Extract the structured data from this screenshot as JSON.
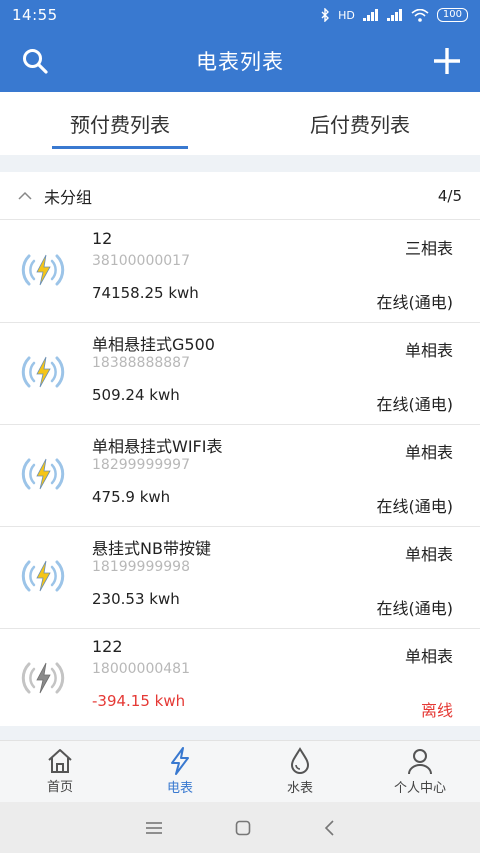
{
  "status_bar": {
    "time": "14:55",
    "signal_label": "HD",
    "battery": "100"
  },
  "app_bar": {
    "title": "电表列表",
    "left_icon": "search-icon",
    "right_icon": "plus-icon"
  },
  "tabs": [
    {
      "label": "预付费列表",
      "active": true
    },
    {
      "label": "后付费列表",
      "active": false
    }
  ],
  "group": {
    "name": "未分组",
    "count": "4/5"
  },
  "meters": [
    {
      "name": "12",
      "code": "38100000017",
      "reading": "74158.25 kwh",
      "type": "三相表",
      "status": "在线(通电)",
      "online": true
    },
    {
      "name": "单相悬挂式G500",
      "code": "18388888887",
      "reading": "509.24 kwh",
      "type": "单相表",
      "status": "在线(通电)",
      "online": true
    },
    {
      "name": "单相悬挂式WIFI表",
      "code": "18299999997",
      "reading": "475.9 kwh",
      "type": "单相表",
      "status": "在线(通电)",
      "online": true
    },
    {
      "name": "悬挂式NB带按键",
      "code": "18199999998",
      "reading": "230.53 kwh",
      "type": "单相表",
      "status": "在线(通电)",
      "online": true
    },
    {
      "name": "122",
      "code": "18000000481",
      "reading": "-394.15 kwh",
      "type": "单相表",
      "status": "离线",
      "online": false
    }
  ],
  "bottom_nav": [
    {
      "label": "首页",
      "icon": "home-icon",
      "active": false
    },
    {
      "label": "电表",
      "icon": "lightning-icon",
      "active": true
    },
    {
      "label": "水表",
      "icon": "water-drop-icon",
      "active": false
    },
    {
      "label": "个人中心",
      "icon": "user-icon",
      "active": false
    }
  ],
  "colors": {
    "primary": "#3979d0",
    "accent_yellow": "#f5c518",
    "error": "#e53935",
    "muted_text": "#b8b8b8"
  }
}
